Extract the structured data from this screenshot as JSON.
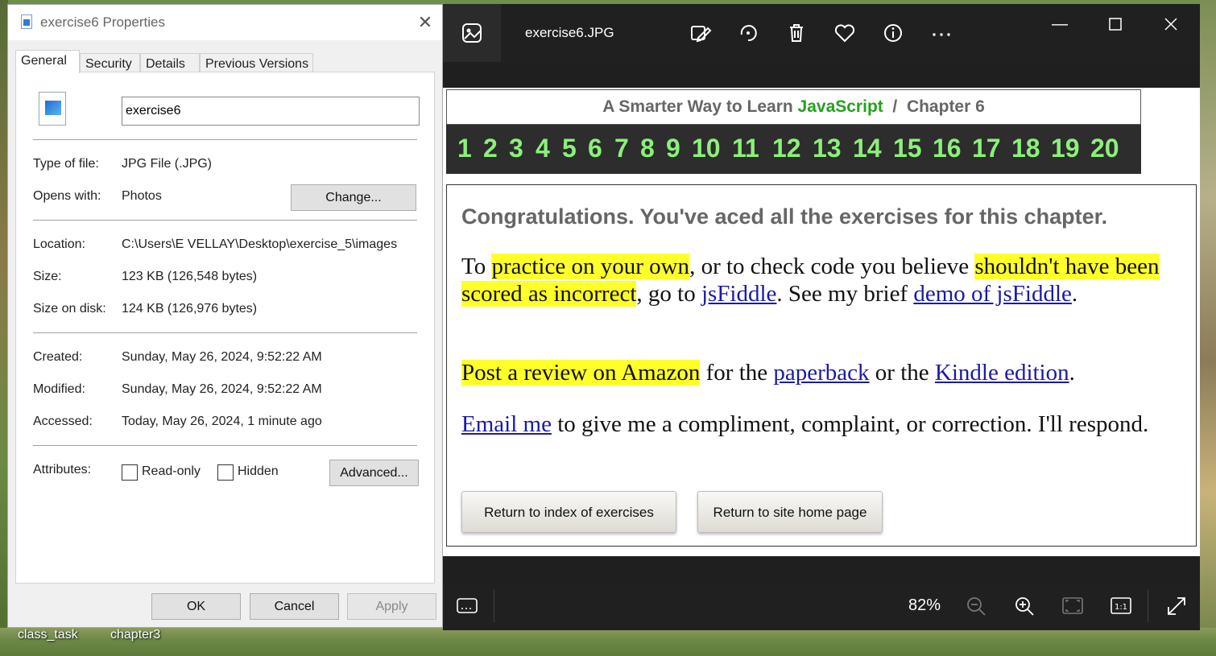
{
  "desktop": {
    "icons": [
      {
        "label": "class_task"
      },
      {
        "label": "chapter3"
      }
    ]
  },
  "properties_dialog": {
    "title": "exercise6 Properties",
    "tabs": [
      "General",
      "Security",
      "Details",
      "Previous Versions"
    ],
    "active_tab": "General",
    "file_name": "exercise6",
    "type_of_file": {
      "label": "Type of file:",
      "value": "JPG File (.JPG)"
    },
    "opens_with": {
      "label": "Opens with:",
      "value": "Photos",
      "button": "Change..."
    },
    "location": {
      "label": "Location:",
      "value": "C:\\Users\\E VELLAY\\Desktop\\exercise_5\\images"
    },
    "size": {
      "label": "Size:",
      "value": "123 KB (126,548 bytes)"
    },
    "size_on_disk": {
      "label": "Size on disk:",
      "value": "124 KB (126,976 bytes)"
    },
    "created": {
      "label": "Created:",
      "value": "Sunday, May 26, 2024, 9:52:22 AM"
    },
    "modified": {
      "label": "Modified:",
      "value": "Sunday, May 26, 2024, 9:52:22 AM"
    },
    "accessed": {
      "label": "Accessed:",
      "value": "Today, May 26, 2024, 1 minute ago"
    },
    "attributes": {
      "label": "Attributes:",
      "read_only": {
        "label": "Read-only",
        "checked": false
      },
      "hidden": {
        "label": "Hidden",
        "checked": false
      },
      "advanced_button": "Advanced..."
    },
    "buttons": {
      "ok": "OK",
      "cancel": "Cancel",
      "apply": "Apply"
    }
  },
  "photos_viewer": {
    "title": "exercise6.JPG",
    "zoom": "82%",
    "toolbar_icons": [
      "photos-app-icon",
      "edit-image-icon",
      "rotate-icon",
      "delete-icon",
      "favorite-icon",
      "info-icon",
      "more-icon"
    ],
    "bottom_icons": [
      "filmstrip-icon",
      "zoom-out-icon",
      "zoom-in-icon",
      "fit-to-window-icon",
      "actual-size-icon",
      "fullscreen-icon"
    ],
    "image_content": {
      "header_prefix": "A Smarter Way to Learn ",
      "header_js": "JavaScript",
      "header_suffix": "  /  Chapter 6",
      "chapters": [
        "1",
        "2",
        "3",
        "4",
        "5",
        "6",
        "7",
        "8",
        "9",
        "10",
        "11",
        "12",
        "13",
        "14",
        "15",
        "16",
        "17",
        "18",
        "19",
        "20"
      ],
      "congrats": "Congratulations. You've aced all the exercises for this chapter.",
      "p1": {
        "t1": "To ",
        "h1": "practice on your own",
        "t2": ", or to check code you believe ",
        "h2": "shouldn't have been scored as incorrect",
        "t3": ", go to ",
        "l1": "jsFiddle",
        "t4": ". See my brief ",
        "l2": "demo of jsFiddle",
        "t5": "."
      },
      "p2": {
        "h1": "Post a review on Amazon",
        "t1": " for the ",
        "l1": "paperback",
        "t2": " or the ",
        "l2": "Kindle edition",
        "t3": "."
      },
      "p3": {
        "l1": "Email me",
        "t1": " to give me a compliment, complaint, or correction. I'll respond."
      },
      "button_index": "Return to index of exercises",
      "button_home": "Return to site home page"
    }
  },
  "colors": {
    "highlight": "#ffff2a",
    "link": "#1a1aa8",
    "js_green": "#25a01f",
    "chapter_green": "#8cf07a"
  }
}
